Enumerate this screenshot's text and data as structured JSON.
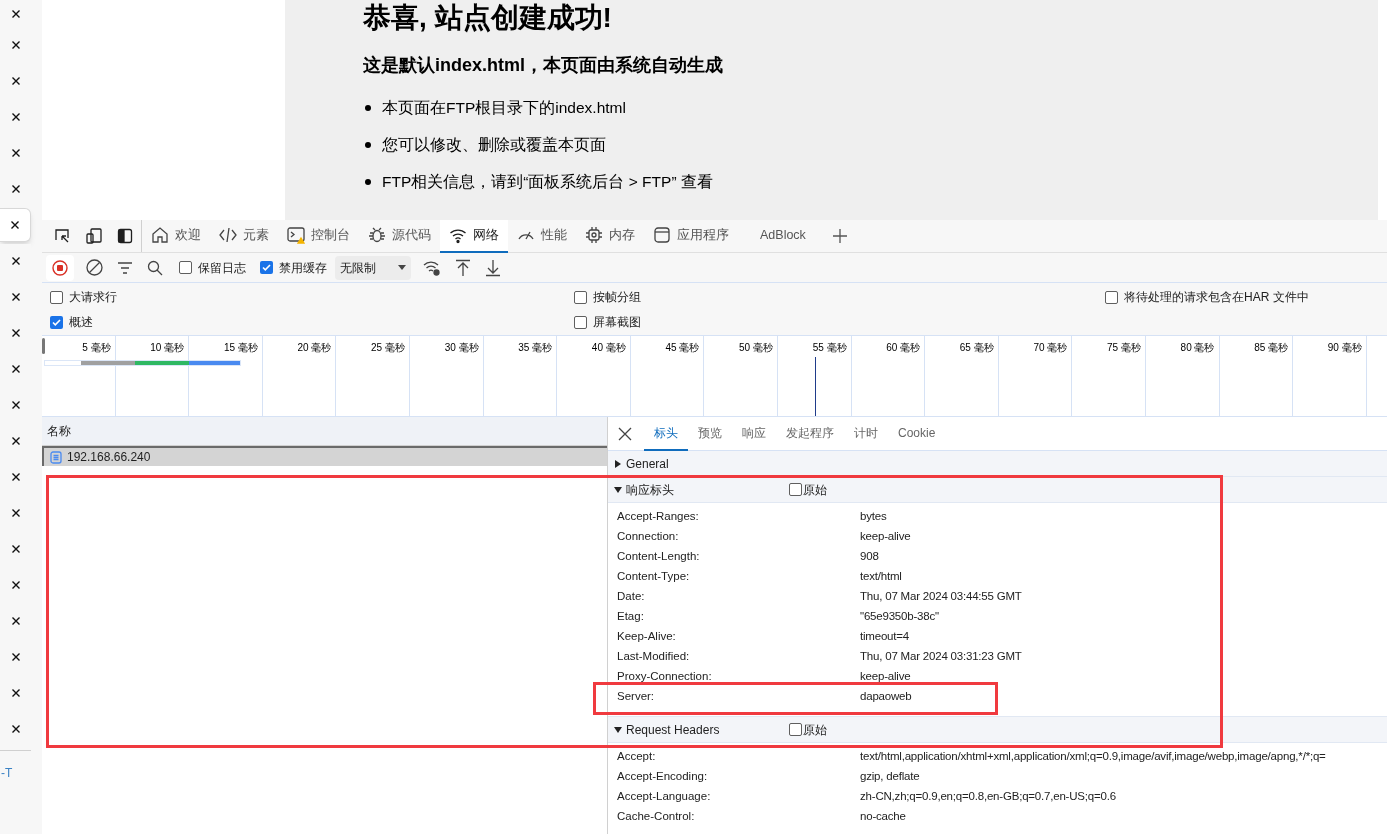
{
  "side_tabs": [
    {
      "selected": false
    },
    {
      "selected": false
    },
    {
      "selected": false
    },
    {
      "selected": false
    },
    {
      "selected": false
    },
    {
      "selected": false
    },
    {
      "selected": true
    },
    {
      "selected": false
    },
    {
      "selected": false
    },
    {
      "selected": false
    },
    {
      "selected": false
    },
    {
      "selected": false
    },
    {
      "selected": false
    },
    {
      "selected": false
    },
    {
      "selected": false
    },
    {
      "selected": false
    },
    {
      "selected": false
    },
    {
      "selected": false
    },
    {
      "selected": false
    },
    {
      "selected": false
    },
    {
      "selected": false
    }
  ],
  "side_footer": "-T",
  "page": {
    "heading": "恭喜, 站点创建成功!",
    "subheading": "这是默认index.html，本页面由系统自动生成",
    "bullets": [
      "本页面在FTP根目录下的index.html",
      "您可以修改、删除或覆盖本页面",
      "FTP相关信息，请到“面板系统后台 > FTP” 查看"
    ]
  },
  "devtools": {
    "tabs": [
      {
        "kind": "home",
        "label": "欢迎",
        "selected": false
      },
      {
        "kind": "code",
        "label": "元素",
        "selected": false
      },
      {
        "kind": "console",
        "label": "控制台",
        "selected": false
      },
      {
        "kind": "bug",
        "label": "源代码",
        "selected": false
      },
      {
        "kind": "wifi",
        "label": "网络",
        "selected": true
      },
      {
        "kind": "gauge",
        "label": "性能",
        "selected": false
      },
      {
        "kind": "chip",
        "label": "内存",
        "selected": false
      },
      {
        "kind": "app",
        "label": "应用程序",
        "selected": false
      },
      {
        "kind": "none",
        "label": "AdBlock",
        "selected": false
      }
    ],
    "toolbar": {
      "recording": true,
      "checkboxes": [
        {
          "label": "保留日志",
          "checked": false
        },
        {
          "label": "禁用缓存",
          "checked": true
        }
      ],
      "throttle": "无限制"
    },
    "options": [
      [
        {
          "label": "大请求行",
          "checked": false
        },
        {
          "label": "概述",
          "checked": true
        }
      ],
      [
        {
          "label": "按帧分组",
          "checked": false
        },
        {
          "label": "屏幕截图",
          "checked": false
        }
      ],
      [
        {
          "label": "将待处理的请求包含在HAR 文件中",
          "checked": false
        }
      ]
    ],
    "timeline": {
      "ticks": [
        "5 毫秒",
        "10 毫秒",
        "15 毫秒",
        "20 毫秒",
        "25 毫秒",
        "30 毫秒",
        "35 毫秒",
        "40 毫秒",
        "45 毫秒",
        "50 毫秒",
        "55 毫秒",
        "60 毫秒",
        "65 毫秒",
        "70 毫秒",
        "75 毫秒",
        "80 毫秒",
        "85 毫秒",
        "90 毫秒"
      ]
    },
    "requests": {
      "column": "名称",
      "rows": [
        {
          "name": "192.168.66.240",
          "selected": true
        }
      ]
    },
    "details": {
      "tabs": [
        {
          "label": "标头",
          "selected": true
        },
        {
          "label": "预览",
          "selected": false
        },
        {
          "label": "响应",
          "selected": false
        },
        {
          "label": "发起程序",
          "selected": false
        },
        {
          "label": "计时",
          "selected": false
        },
        {
          "label": "Cookie",
          "selected": false
        }
      ],
      "sections": [
        {
          "title": "General",
          "expanded": false
        },
        {
          "title": "响应标头",
          "expanded": true,
          "raw": {
            "label": "原始",
            "checked": false
          },
          "rows": [
            {
              "name": "Accept-Ranges:",
              "value": "bytes"
            },
            {
              "name": "Connection:",
              "value": "keep-alive"
            },
            {
              "name": "Content-Length:",
              "value": "908"
            },
            {
              "name": "Content-Type:",
              "value": "text/html"
            },
            {
              "name": "Date:",
              "value": "Thu, 07 Mar 2024 03:44:55 GMT"
            },
            {
              "name": "Etag:",
              "value": "\"65e9350b-38c\""
            },
            {
              "name": "Keep-Alive:",
              "value": "timeout=4"
            },
            {
              "name": "Last-Modified:",
              "value": "Thu, 07 Mar 2024 03:31:23 GMT"
            },
            {
              "name": "Proxy-Connection:",
              "value": "keep-alive"
            },
            {
              "name": "Server:",
              "value": "dapaoweb"
            }
          ]
        },
        {
          "title": "Request Headers",
          "expanded": true,
          "raw": {
            "label": "原始",
            "checked": false
          },
          "rows": [
            {
              "name": "Accept:",
              "value": "text/html,application/xhtml+xml,application/xml;q=0.9,image/avif,image/webp,image/apng,*/*;q="
            },
            {
              "name": "Accept-Encoding:",
              "value": "gzip, deflate"
            },
            {
              "name": "Accept-Language:",
              "value": "zh-CN,zh;q=0.9,en;q=0.8,en-GB;q=0.7,en-US;q=0.6"
            },
            {
              "name": "Cache-Control:",
              "value": "no-cache"
            }
          ]
        }
      ]
    }
  }
}
